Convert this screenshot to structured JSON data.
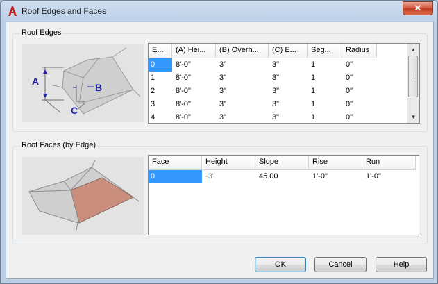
{
  "window": {
    "title": "Roof Edges and Faces",
    "close_glyph": "✕"
  },
  "edges": {
    "group_label": "Roof Edges",
    "diagram_labels": {
      "a": "A",
      "b": "B",
      "c": "C"
    },
    "columns": [
      "E...",
      "(A) Hei...",
      "(B) Overh...",
      "(C) E...",
      "Seg...",
      "Radius"
    ],
    "rows": [
      [
        "0",
        "8'-0\"",
        "3\"",
        "3\"",
        "1",
        "0\""
      ],
      [
        "1",
        "8'-0\"",
        "3\"",
        "3\"",
        "1",
        "0\""
      ],
      [
        "2",
        "8'-0\"",
        "3\"",
        "3\"",
        "1",
        "0\""
      ],
      [
        "3",
        "8'-0\"",
        "3\"",
        "3\"",
        "1",
        "0\""
      ],
      [
        "4",
        "8'-0\"",
        "3\"",
        "3\"",
        "1",
        "0\""
      ]
    ]
  },
  "faces": {
    "group_label": "Roof Faces (by Edge)",
    "columns": [
      "Face",
      "Height",
      "Slope",
      "Rise",
      "Run"
    ],
    "rows": [
      [
        "0",
        "-3\"",
        "45.00",
        "1'-0\"",
        "1'-0\""
      ]
    ]
  },
  "buttons": {
    "ok": "OK",
    "cancel": "Cancel",
    "help": "Help"
  },
  "colors": {
    "selection": "#3399ff",
    "highlight_face": "#c98f7c",
    "close_red": "#c23a20"
  }
}
